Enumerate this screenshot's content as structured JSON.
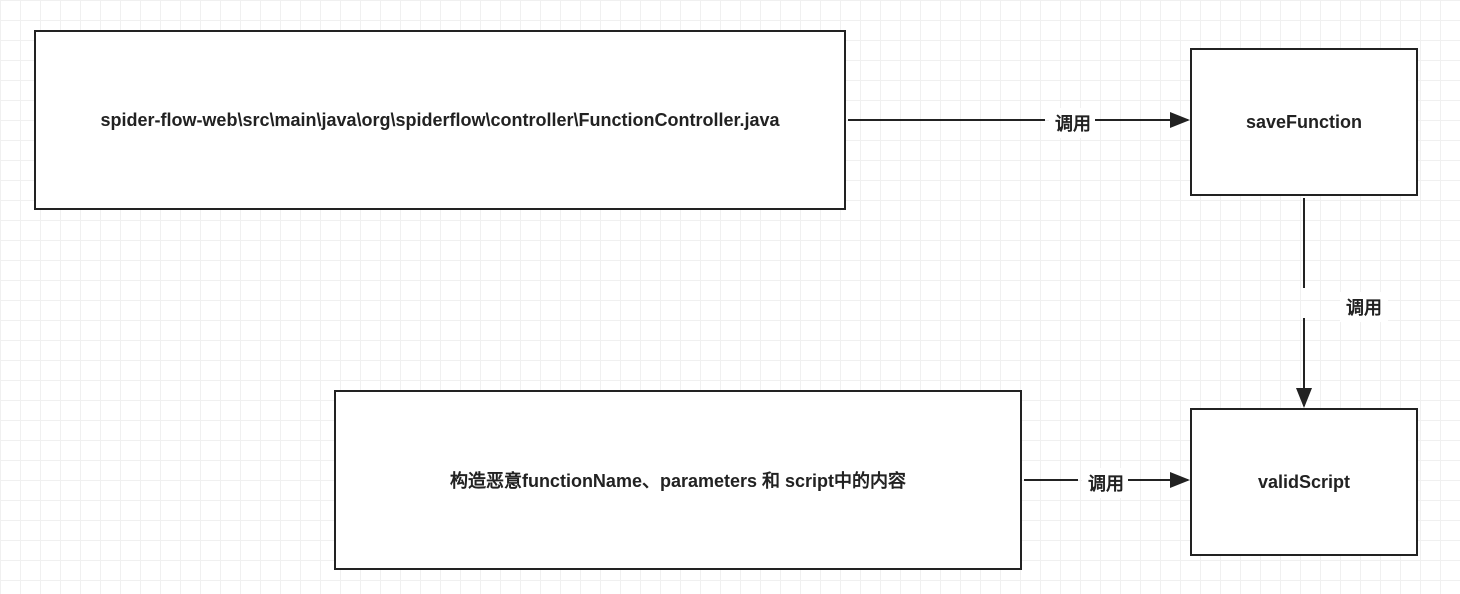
{
  "nodes": {
    "controller": "spider-flow-web\\src\\main\\java\\org\\spiderflow\\controller\\FunctionController.java",
    "saveFunction": "saveFunction",
    "payload": "构造恶意functionName、parameters 和 script中的内容",
    "validScript": "validScript"
  },
  "edges": {
    "e1": "调用",
    "e2": "调用",
    "e3": "调用"
  }
}
